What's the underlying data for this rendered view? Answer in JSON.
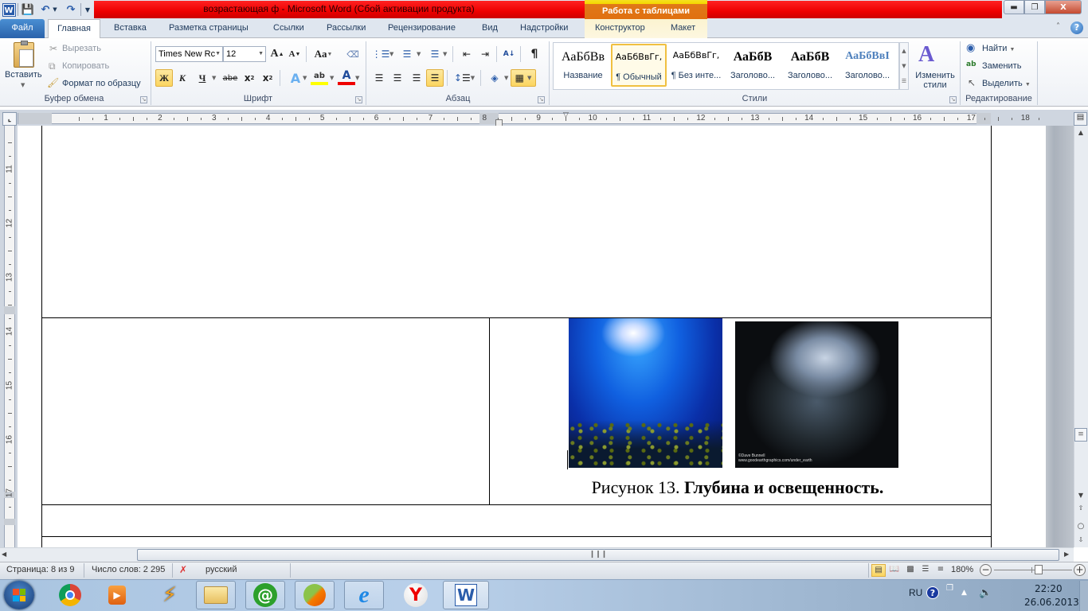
{
  "window": {
    "title": "возрастающая ф  -  Microsoft Word (Сбой активации продукта)",
    "contextual_tab_group": "Работа с таблицами",
    "controls": [
      "minimize",
      "restore",
      "close"
    ]
  },
  "quick_access": [
    "word-logo",
    "save",
    "undo",
    "undo-dropdown",
    "redo",
    "customize"
  ],
  "tabs": [
    {
      "label": "Файл"
    },
    {
      "label": "Главная",
      "active": true
    },
    {
      "label": "Вставка"
    },
    {
      "label": "Разметка страницы"
    },
    {
      "label": "Ссылки"
    },
    {
      "label": "Рассылки"
    },
    {
      "label": "Рецензирование"
    },
    {
      "label": "Вид"
    },
    {
      "label": "Надстройки"
    },
    {
      "label": "Конструктор"
    },
    {
      "label": "Макет"
    }
  ],
  "ribbon": {
    "clipboard": {
      "label": "Буфер обмена",
      "paste": "Вставить",
      "cut": "Вырезать",
      "copy": "Копировать",
      "format_painter": "Формат по образцу"
    },
    "font": {
      "label": "Шрифт",
      "font_name": "Times New Rc",
      "font_size": "12",
      "bold_glyph": "Ж",
      "italic_glyph": "К",
      "underline_glyph": "Ч",
      "strike_glyph": "abe",
      "change_case_glyph": "Aa",
      "bold_active": true
    },
    "paragraph": {
      "label": "Абзац",
      "justify_active": true
    },
    "styles": {
      "label": "Стили",
      "items": [
        {
          "sample": "АаБбВв",
          "name": "Название"
        },
        {
          "sample": "АаБбВвГг,",
          "name": "¶ Обычный",
          "selected": true
        },
        {
          "sample": "АаБбВвГг,",
          "name": "¶ Без инте..."
        },
        {
          "sample": "АаБбВ",
          "name": "Заголово..."
        },
        {
          "sample": "АаБбВ",
          "name": "Заголово..."
        },
        {
          "sample": "АаБбВвI",
          "name": "Заголово..."
        }
      ],
      "change_styles": "Изменить стили"
    },
    "editing": {
      "label": "Редактирование",
      "find": "Найти",
      "replace": "Заменить",
      "select": "Выделить"
    }
  },
  "ruler": {
    "horizontal_numbers": [
      "1",
      "2",
      "3",
      "4",
      "5",
      "6",
      "7",
      "8",
      "9",
      "10",
      "11",
      "12",
      "13",
      "14",
      "15",
      "16",
      "17",
      "18"
    ],
    "vertical_numbers": [
      "11",
      "12",
      "13",
      "14",
      "15",
      "16",
      "17"
    ]
  },
  "document": {
    "caption_prefix": "Рисунок 13. ",
    "caption_bold": "Глубина и освещенность.",
    "image_left": "underwater-sunlight-photo",
    "image_right": "cave-shaft-photo",
    "image_right_credit_1": "©Dave Bunnell",
    "image_right_credit_2": "www.goodearthgraphics.com/under_earth"
  },
  "statusbar": {
    "page": "Страница: 8 из 9",
    "words": "Число слов: 2 295",
    "language": "русский",
    "zoom": "180%",
    "zoom_percent": 180
  },
  "taskbar": {
    "apps": [
      "start",
      "chrome",
      "media-player",
      "winamp",
      "explorer",
      "mail-agent",
      "app-orange-green",
      "internet-explorer",
      "yandex-browser",
      "word"
    ],
    "lang": "RU",
    "time": "22:20",
    "date": "26.06.2013"
  },
  "colors": {
    "title_red": "#ee0000",
    "table_tools_orange": "#e07010",
    "file_tab_blue": "#2a62ab",
    "active_highlight": "#fbd560"
  }
}
